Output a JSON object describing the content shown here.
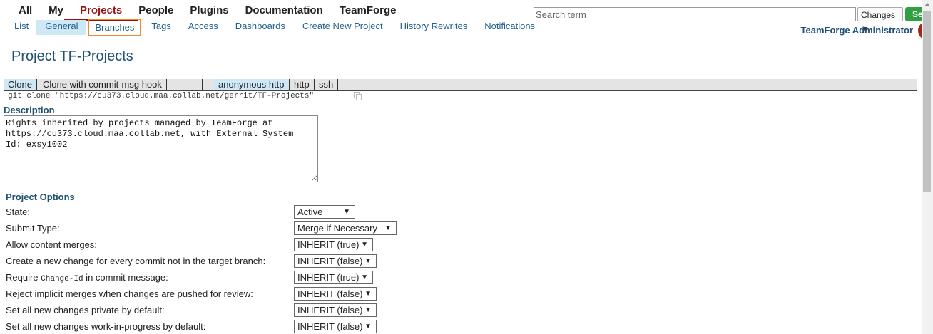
{
  "nav": {
    "top": [
      "All",
      "My",
      "Projects",
      "People",
      "Plugins",
      "Documentation",
      "TeamForge"
    ],
    "sub": [
      "List",
      "General",
      "Branches",
      "Tags",
      "Access",
      "Dashboards",
      "Create New Project",
      "History Rewrites",
      "Notifications"
    ]
  },
  "search": {
    "placeholder": "Search term",
    "scope": "Changes ▼",
    "button": "Se"
  },
  "user": {
    "name": "TeamForge Administrator"
  },
  "page": {
    "title": "Project TF-Projects"
  },
  "clone": {
    "tabs": [
      "Clone",
      "Clone with commit-msg hook",
      "anonymous http",
      "http",
      "ssh"
    ],
    "command": "git clone \"https://cu373.cloud.maa.collab.net/gerrit/TF-Projects\""
  },
  "description": {
    "label": "Description",
    "text": "Rights inherited by projects managed by TeamForge at\nhttps://cu373.cloud.maa.collab.net, with External System\nId: exsy1002"
  },
  "options": {
    "heading": "Project Options",
    "state_label": "State:",
    "state_value": "Active",
    "submit_label": "Submit Type:",
    "submit_value": "Merge if Necessary",
    "content_merges_label": "Allow content merges:",
    "content_merges_value": "INHERIT (true)",
    "new_change_label": "Create a new change for every commit not in the target branch:",
    "new_change_value": "INHERIT (false)",
    "changeid_prefix": "Require ",
    "changeid_code": "Change-Id",
    "changeid_suffix": " in commit message:",
    "changeid_value": "INHERIT (true)",
    "reject_label": "Reject implicit merges when changes are pushed for review:",
    "reject_value": "INHERIT (false)",
    "private_label": "Set all new changes private by default:",
    "private_value": "INHERIT (false)",
    "wip_label": "Set all new changes work-in-progress by default:",
    "wip_value": "INHERIT (false)"
  },
  "colors": {
    "accent": "#9a1111",
    "link": "#1f5f8c",
    "highlight": "#ef8a32",
    "selected": "#cfe8f6",
    "go": "#2ea043"
  }
}
